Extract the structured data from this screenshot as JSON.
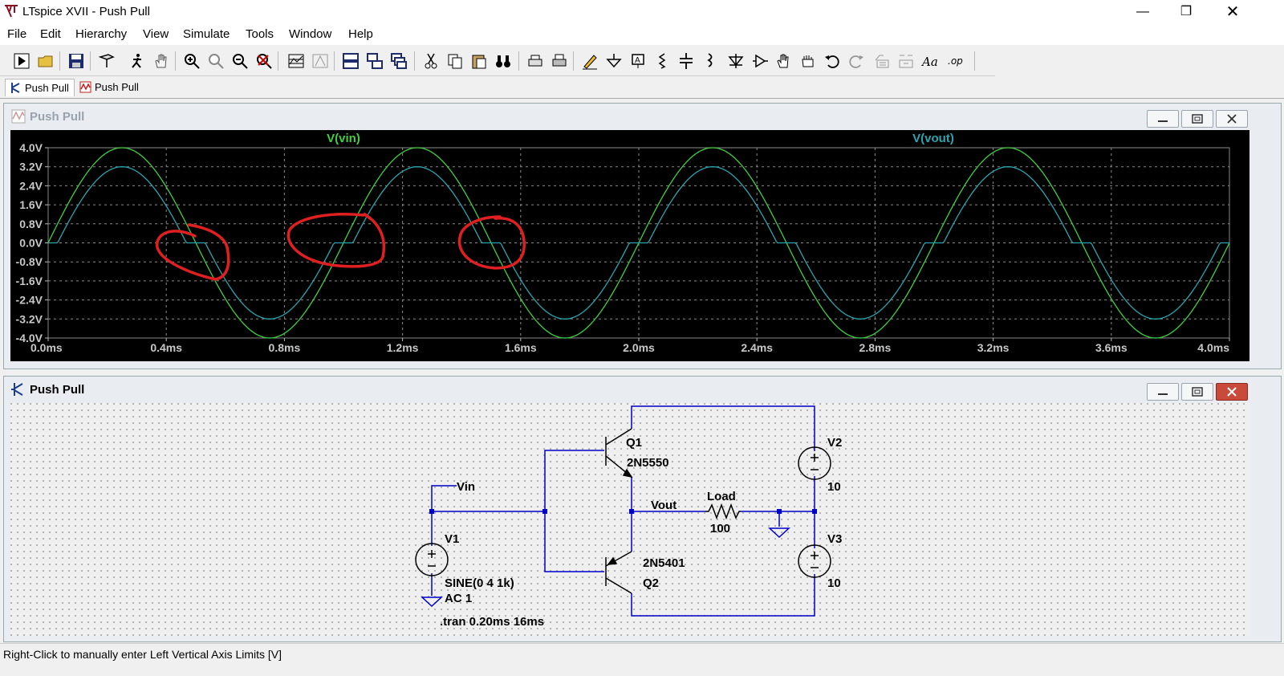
{
  "window": {
    "title": "LTspice XVII - Push Pull",
    "controls": [
      "minimize",
      "maximize",
      "close"
    ]
  },
  "menu": {
    "items": [
      "File",
      "Edit",
      "Hierarchy",
      "View",
      "Simulate",
      "Tools",
      "Window",
      "Help"
    ]
  },
  "toolbar": {
    "buttons": [
      "run",
      "open",
      "save",
      "control-panel",
      "halt",
      "pan",
      "zoom-in",
      "zoom-full",
      "zoom-out",
      "zoom-cancel",
      "autorange",
      "mark-ref",
      "tile-horiz",
      "tile-vert",
      "cascade",
      "cut",
      "copy",
      "paste",
      "find",
      "print-setup",
      "print",
      "draw-wire",
      "ground",
      "label-net",
      "resistor",
      "capacitor",
      "inductor",
      "diode",
      "component",
      "move",
      "drag",
      "undo",
      "redo",
      "rotate",
      "mirror",
      "text",
      "spice-directive"
    ]
  },
  "tabs": [
    {
      "label": "Push Pull",
      "kind": "schematic"
    },
    {
      "label": "Push Pull",
      "kind": "waveform"
    }
  ],
  "waveform_window": {
    "title": "Push Pull"
  },
  "schematic_window": {
    "title": "Push Pull"
  },
  "chart_data": {
    "type": "line",
    "title": "",
    "xlabel": "",
    "ylabel": "",
    "xlim": [
      0,
      4.0
    ],
    "ylim": [
      -4.0,
      4.0
    ],
    "x_ticks": [
      "0.0ms",
      "0.4ms",
      "0.8ms",
      "1.2ms",
      "1.6ms",
      "2.0ms",
      "2.4ms",
      "2.8ms",
      "3.2ms",
      "3.6ms",
      "4.0ms"
    ],
    "y_ticks": [
      "4.0V",
      "3.2V",
      "2.4V",
      "1.6V",
      "0.8V",
      "0.0V",
      "-0.8V",
      "-1.6V",
      "-2.4V",
      "-3.2V",
      "-4.0V"
    ],
    "grid": true,
    "legend_position": "top",
    "series": [
      {
        "name": "V(vin)",
        "color": "#40d040",
        "function": "sine",
        "amplitude": 4.0,
        "frequency_khz": 1,
        "deadband": 0
      },
      {
        "name": "V(vout)",
        "color": "#2aa6b0",
        "function": "sine-with-crossover",
        "amplitude": 3.2,
        "frequency_khz": 1,
        "deadband": 0.8
      }
    ],
    "annotations": [
      "red-circle",
      "red-circle",
      "red-circle"
    ]
  },
  "schematic": {
    "labels": {
      "q1_name": "Q1",
      "q1_model": "2N5550",
      "q2_name": "Q2",
      "q2_model": "2N5401",
      "v1_name": "V1",
      "v1_value": "SINE(0 4 1k)",
      "v1_ac": "AC 1",
      "v2_name": "V2",
      "v2_value": "10",
      "v3_name": "V3",
      "v3_value": "10",
      "load_name": "Load",
      "load_value": "100",
      "vin_net": "Vin",
      "vout_net": "Vout",
      "directive": ".tran 0.20ms 16ms"
    },
    "wire_color": "#0000c8"
  },
  "status": {
    "text": "Right-Click to manually enter Left Vertical Axis Limits [V]"
  }
}
